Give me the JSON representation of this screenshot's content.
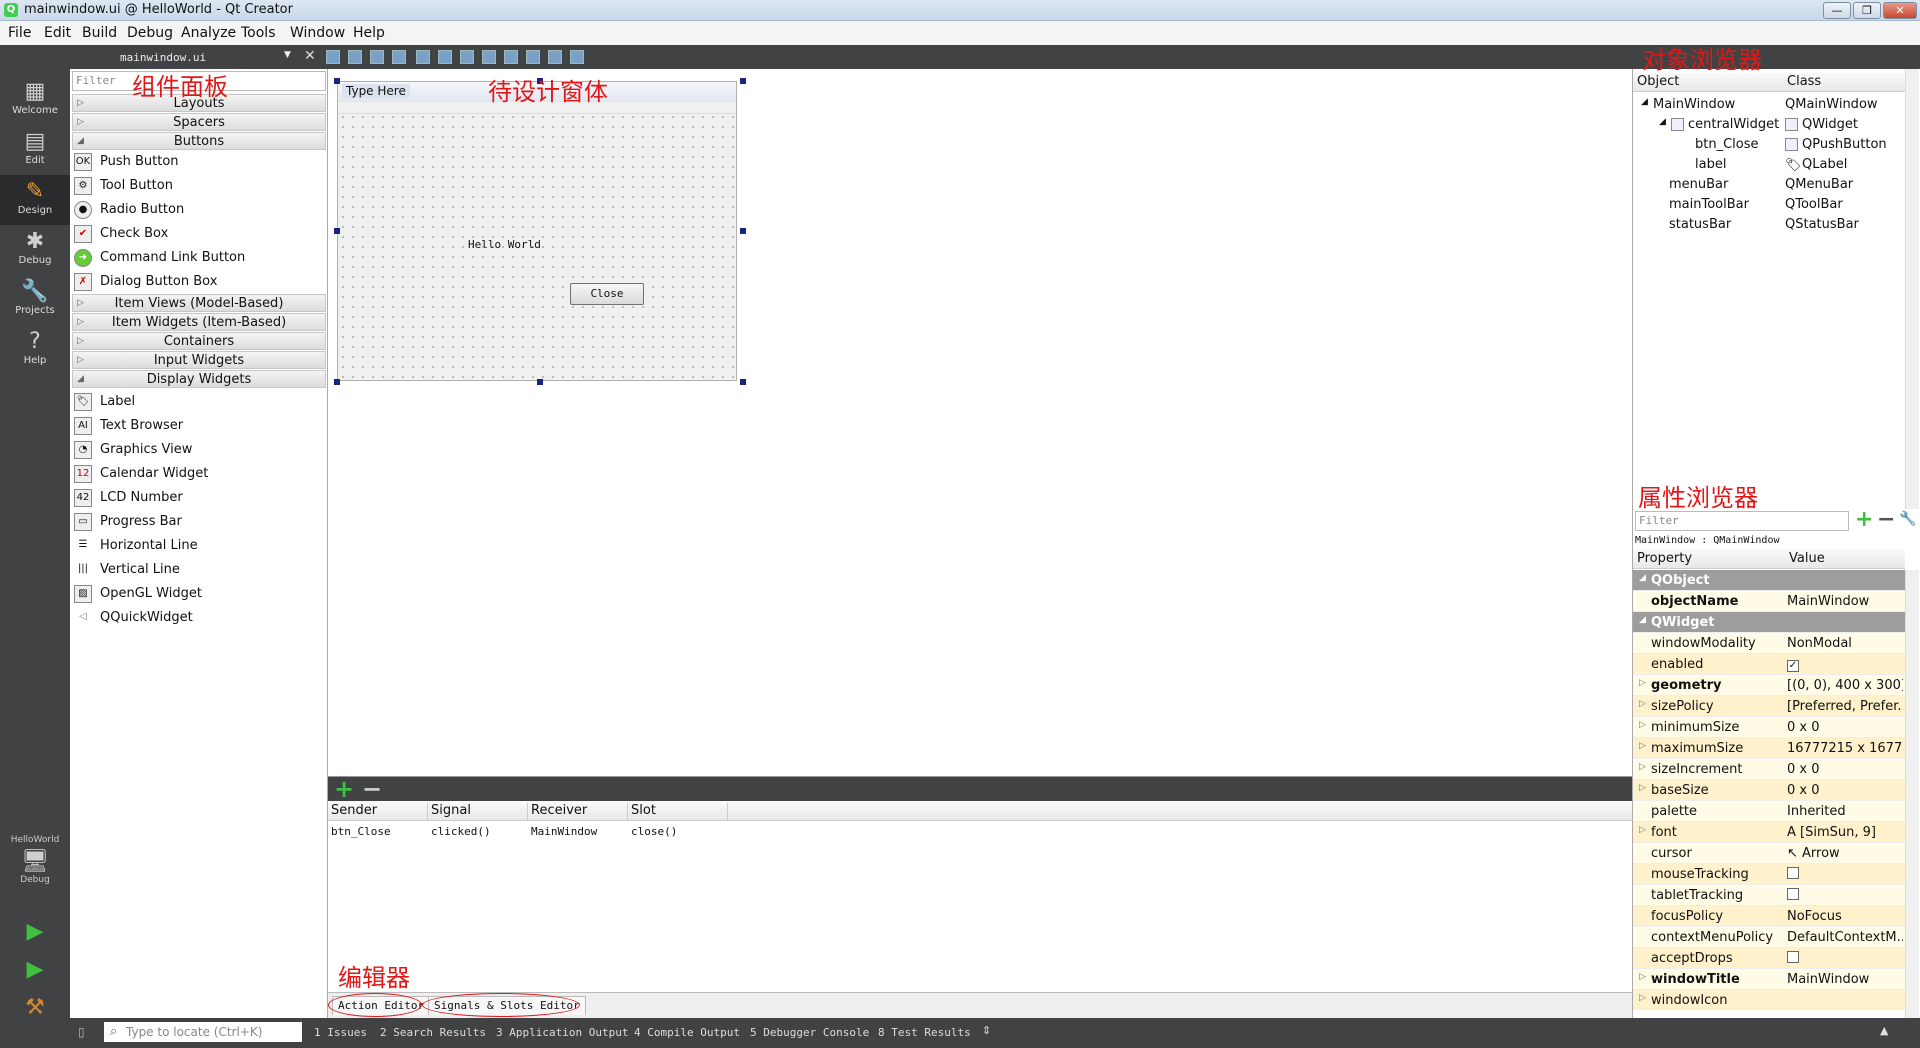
{
  "window": {
    "title": "mainwindow.ui @ HelloWorld - Qt Creator"
  },
  "menu": [
    "File",
    "Edit",
    "Build",
    "Debug",
    "Analyze",
    "Tools",
    "Window",
    "Help"
  ],
  "modes": [
    "Welcome",
    "Edit",
    "Design",
    "Debug",
    "Projects",
    "Help"
  ],
  "kit": {
    "project": "HelloWorld",
    "config": "Debug"
  },
  "file_tab": "mainwindow.ui",
  "annotations": {
    "widget_box": "组件面板",
    "form": "待设计窗体",
    "object_inspector": "对象浏览器",
    "property_editor": "属性浏览器",
    "editor": "编辑器"
  },
  "widget_box": {
    "filter_placeholder": "Filter",
    "categories": [
      "Layouts",
      "Spacers",
      "Buttons",
      "Item Views (Model-Based)",
      "Item Widgets (Item-Based)",
      "Containers",
      "Input Widgets",
      "Display Widgets"
    ],
    "buttons": [
      "Push Button",
      "Tool Button",
      "Radio Button",
      "Check Box",
      "Command Link Button",
      "Dialog Button Box"
    ],
    "display": [
      "Label",
      "Text Browser",
      "Graphics View",
      "Calendar Widget",
      "LCD Number",
      "Progress Bar",
      "Horizontal Line",
      "Vertical Line",
      "OpenGL Widget",
      "QQuickWidget"
    ]
  },
  "form": {
    "menu_placeholder": "Type Here",
    "label": "Hello World",
    "button": "Close"
  },
  "signals_editor": {
    "headers": [
      "Sender",
      "Signal",
      "Receiver",
      "Slot"
    ],
    "row": [
      "btn_Close",
      "clicked()",
      "MainWindow",
      "close()"
    ]
  },
  "bottom_tabs": [
    "Action Editor",
    "Signals & Slots Editor"
  ],
  "object_inspector": {
    "headers": [
      "Object",
      "Class"
    ],
    "rows": [
      [
        "MainWindow",
        "QMainWindow"
      ],
      [
        "centralWidget",
        "QWidget"
      ],
      [
        "btn_Close",
        "QPushButton"
      ],
      [
        "label",
        "QLabel"
      ],
      [
        "menuBar",
        "QMenuBar"
      ],
      [
        "mainToolBar",
        "QToolBar"
      ],
      [
        "statusBar",
        "QStatusBar"
      ]
    ]
  },
  "property_editor": {
    "filter_placeholder": "Filter",
    "path": "MainWindow : QMainWindow",
    "headers": [
      "Property",
      "Value"
    ],
    "rows": [
      [
        "QObject",
        ""
      ],
      [
        "objectName",
        "MainWindow"
      ],
      [
        "QWidget",
        ""
      ],
      [
        "windowModality",
        "NonModal"
      ],
      [
        "enabled",
        "✓"
      ],
      [
        "geometry",
        "[(0, 0), 400 x 300]"
      ],
      [
        "sizePolicy",
        "[Preferred, Prefer..."
      ],
      [
        "minimumSize",
        "0 x 0"
      ],
      [
        "maximumSize",
        "16777215 x 1677..."
      ],
      [
        "sizeIncrement",
        "0 x 0"
      ],
      [
        "baseSize",
        "0 x 0"
      ],
      [
        "palette",
        "Inherited"
      ],
      [
        "font",
        "[SimSun, 9]"
      ],
      [
        "cursor",
        "Arrow"
      ],
      [
        "mouseTracking",
        ""
      ],
      [
        "tabletTracking",
        ""
      ],
      [
        "focusPolicy",
        "NoFocus"
      ],
      [
        "contextMenuPolicy",
        "DefaultContextM..."
      ],
      [
        "acceptDrops",
        ""
      ],
      [
        "windowTitle",
        "MainWindow"
      ],
      [
        "windowIcon",
        ""
      ]
    ]
  },
  "statusbar": {
    "locate_placeholder": "Type to locate (Ctrl+K)",
    "tabs": [
      "1 Issues",
      "2 Search Results",
      "3 Application Output",
      "4 Compile Output",
      "5 Debugger Console",
      "8 Test Results"
    ]
  }
}
